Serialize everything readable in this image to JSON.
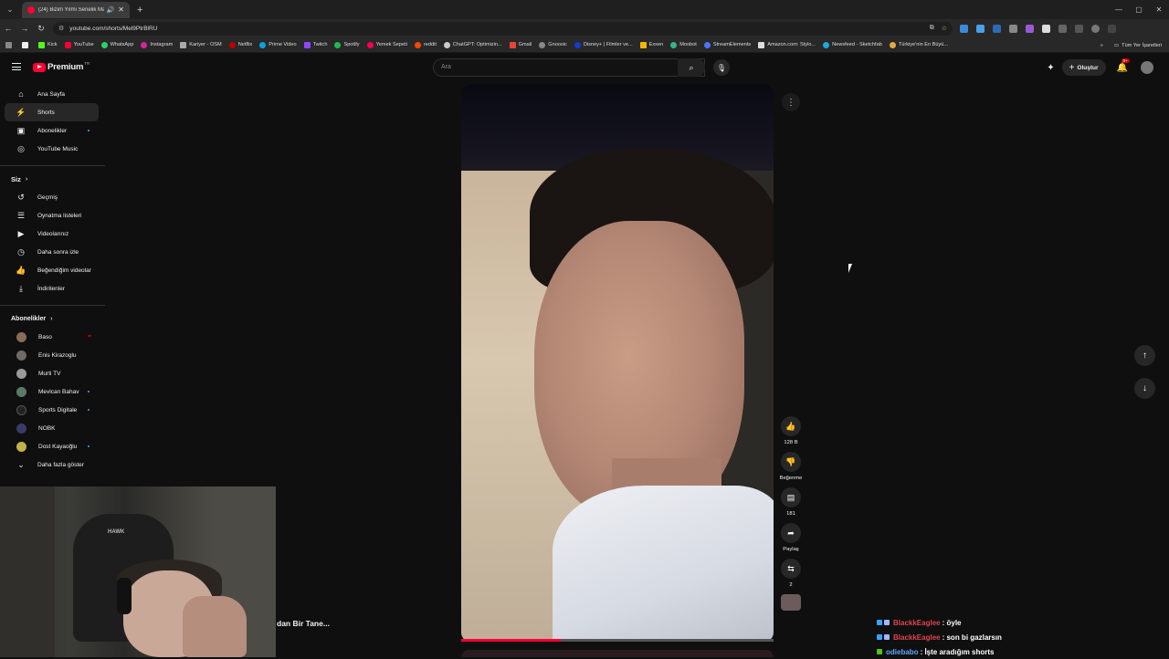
{
  "browser": {
    "tab_title": "(24) Bizim Yirmi Senelik Ma",
    "address": "youtube.com/shorts/Mel9PtrBlRU",
    "bookmarks": [
      "Kick",
      "YouTube",
      "WhatsApp",
      "Instagram",
      "Kariyer - OSM",
      "Netflix",
      "Prime Video",
      "Twitch",
      "Spotify",
      "Yemek Sepeti",
      "reddit",
      "ChatGPT: Optimizin...",
      "Gmail",
      "Gnoosic",
      "Disney+ | Filmler ve...",
      "Exxen",
      "Moobot",
      "StreamElements",
      "Amazon.com: Stylo...",
      "Newsfeed - Sketchfab",
      "Türkiye'nin En Büyü..."
    ],
    "bookmarks_all": "Tüm Yer İşaretleri"
  },
  "header": {
    "logo_text": "Premium",
    "country_code": "TR",
    "search_placeholder": "Ara",
    "create_label": "Oluştur",
    "notif_badge": "9+"
  },
  "sidebar": {
    "main": [
      {
        "label": "Ana Sayfa",
        "icon": "home-icon"
      },
      {
        "label": "Shorts",
        "icon": "shorts-icon"
      },
      {
        "label": "Abonelikler",
        "icon": "subscriptions-icon"
      },
      {
        "label": "YouTube Music",
        "icon": "music-icon"
      }
    ],
    "you_title": "Siz",
    "you": [
      {
        "label": "Geçmiş",
        "icon": "history-icon"
      },
      {
        "label": "Oynatma listeleri",
        "icon": "playlist-icon"
      },
      {
        "label": "Videolarınız",
        "icon": "your-videos-icon"
      },
      {
        "label": "Daha sonra izle",
        "icon": "watch-later-icon"
      },
      {
        "label": "Beğendiğim videolar",
        "icon": "liked-icon"
      },
      {
        "label": "İndirilenler",
        "icon": "download-icon"
      }
    ],
    "subs_title": "Abonelikler",
    "subs": [
      {
        "label": "Baso",
        "color": "#8a6b5a"
      },
      {
        "label": "Enis Kirazoglu",
        "color": "#6f6a66"
      },
      {
        "label": "Murti TV",
        "color": "#9a9a9a"
      },
      {
        "label": "Mevlcan Bahav",
        "color": "#5a7a6a"
      },
      {
        "label": "Sports Digitale",
        "color": "#222222"
      },
      {
        "label": "NOBK",
        "color": "#3a3a6a"
      },
      {
        "label": "Dost Kayaoğlu",
        "color": "#c2b24a"
      }
    ],
    "show_more": "Daha fazla göster"
  },
  "webcam": {
    "chair_brand": "HAWK"
  },
  "caption": "dan Bir Tane...",
  "short": {
    "likes": "128 B",
    "dislike_label": "Beğenme",
    "comments": "181",
    "share_label": "Paylaş",
    "remix_count": "2",
    "progress": 0.32
  },
  "chat": [
    {
      "user": "BlackkEaglee",
      "msg": ": öyle",
      "color": "#e0434f"
    },
    {
      "user": "BlackkEaglee",
      "msg": ": son bi gazlarsın",
      "color": "#e0434f"
    },
    {
      "user": "odiebabo",
      "msg": ": İşte aradığım shorts",
      "color": "#5fa8ff"
    }
  ]
}
